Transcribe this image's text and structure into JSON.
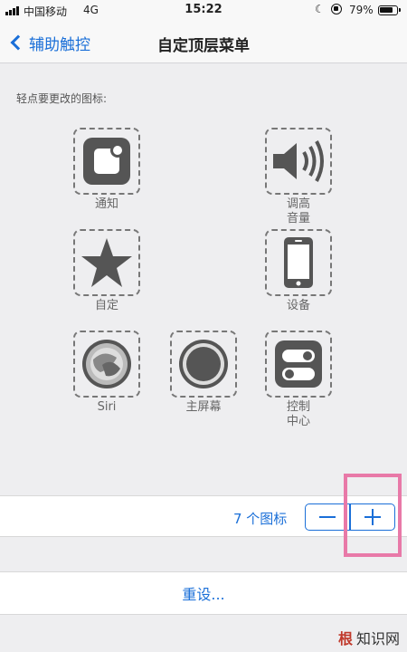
{
  "status_bar": {
    "carrier": "中国移动",
    "network": "4G",
    "time": "15:22",
    "battery_percent": "79%",
    "moon_glyph": "☾"
  },
  "nav": {
    "back_label": "辅助触控",
    "title": "自定顶层菜单"
  },
  "section_label": "轻点要更改的图标:",
  "icons": [
    {
      "label_line1": "通知",
      "label_line2": ""
    },
    {
      "label_line1": "调高",
      "label_line2": "音量"
    },
    {
      "label_line1": "自定",
      "label_line2": ""
    },
    {
      "label_line1": "设备",
      "label_line2": ""
    },
    {
      "label_line1": "Siri",
      "label_line2": ""
    },
    {
      "label_line1": "主屏幕",
      "label_line2": ""
    },
    {
      "label_line1": "控制",
      "label_line2": "中心"
    }
  ],
  "stepper": {
    "count_label": "7 个图标"
  },
  "reset_label": "重设...",
  "watermark": {
    "logo_text": "根",
    "text": "知识网"
  },
  "colors": {
    "accent": "#1a6fd8",
    "highlight": "#e879a8",
    "icon_gray": "#555555"
  }
}
